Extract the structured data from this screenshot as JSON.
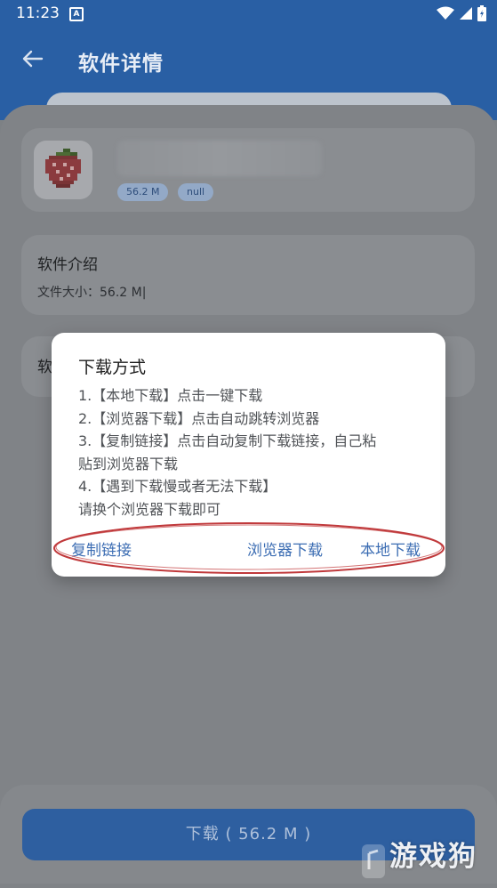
{
  "status_bar": {
    "time": "11:23",
    "notification_glyph": "A",
    "icons": [
      "wifi-icon",
      "signal-icon",
      "battery-icon"
    ]
  },
  "header": {
    "title": "软件详情"
  },
  "app_card": {
    "size_chip": "56.2 M",
    "extra_chip": "null"
  },
  "intro_card": {
    "title": "软件介绍",
    "file_size": "文件大小：56.2 M|"
  },
  "third_card": {
    "label": "软"
  },
  "dialog": {
    "title": "下载方式",
    "lines": [
      "1.【本地下载】点击一键下载",
      "2.【浏览器下载】点击自动跳转浏览器",
      "3.【复制链接】点击自动复制下载链接，自己粘",
      "贴到浏览器下载",
      "4.【遇到下载慢或者无法下载】",
      "请换个浏览器下载即可"
    ],
    "actions": {
      "copy_link": "复制链接",
      "browser_download": "浏览器下载",
      "local_download": "本地下载"
    },
    "annotation_color": "#c0393b"
  },
  "bottom": {
    "download_label": "下载 ( 56.2 M )"
  },
  "watermark": {
    "text": "游戏狗"
  },
  "colors": {
    "appbar": "#295fa4",
    "accent_text": "#3c6db3",
    "download_button": "#2e5fa0"
  }
}
